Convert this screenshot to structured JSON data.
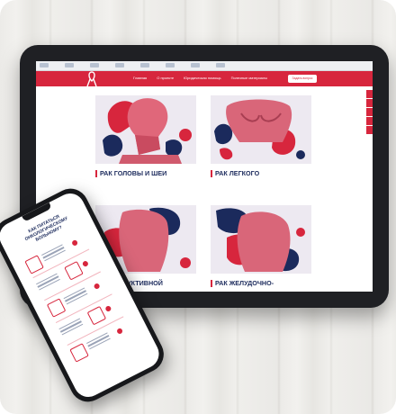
{
  "tablet": {
    "nav": [
      "Главная",
      "О проекте",
      "Юридическая помощь",
      "Полезные материалы"
    ],
    "cta_label": "Задать вопрос",
    "cards": [
      {
        "title": "РАК ГОЛОВЫ И ШЕИ"
      },
      {
        "title": "РАК ЛЕГКОГО"
      },
      {
        "title": "РЕПРОДУКТИВНОЙ"
      },
      {
        "title": "РАК ЖЕЛУДОЧНО-"
      }
    ],
    "social_count": 5
  },
  "phone": {
    "title": "КАК ПИТАТЬСЯ ОНКОЛОГИЧЕСКОМУ БОЛЬНОМУ?"
  },
  "colors": {
    "brand_red": "#d7263d",
    "brand_navy": "#1b2a5c"
  }
}
